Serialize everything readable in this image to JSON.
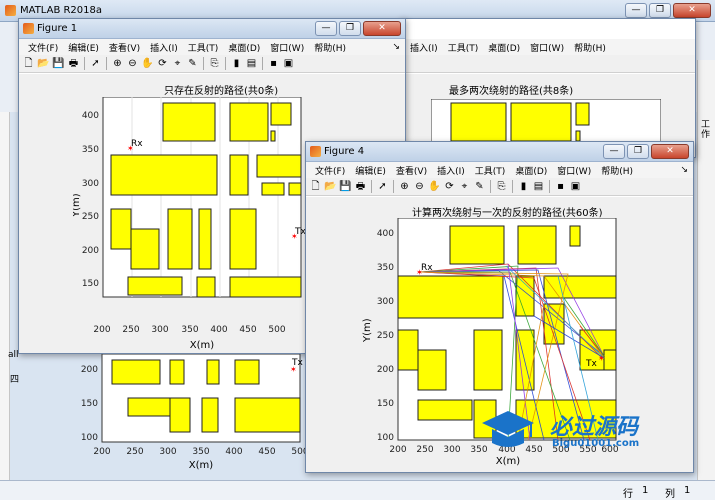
{
  "app": {
    "title": "MATLAB R2018a"
  },
  "figure1": {
    "title": "Figure 1",
    "plot_title": "只存在反射的路径(共0条)"
  },
  "figure_behind": {
    "plot_title": "最多两次绕射的路径(共8条)"
  },
  "figure4": {
    "title": "Figure 4",
    "plot_title": "计算两次绕射与一次的反射的路径(共60条)"
  },
  "menu": [
    "文件(F)",
    "编辑(E)",
    "查看(V)",
    "插入(I)",
    "工具(T)",
    "桌面(D)",
    "窗口(W)",
    "帮助(H)"
  ],
  "menu_tail": "↘",
  "axes": {
    "xlabel": "X(m)",
    "ylabel": "Y(m)",
    "rx_label": "Rx",
    "tx_label": "Tx"
  },
  "ticks": {
    "x": [
      "200",
      "250",
      "300",
      "350",
      "400",
      "450",
      "500"
    ],
    "y": [
      "100",
      "150",
      "200",
      "250",
      "300",
      "350",
      "400"
    ]
  },
  "ticks_fig4": {
    "x": [
      "200",
      "250",
      "300",
      "350",
      "400",
      "450",
      "500",
      "550",
      "600"
    ]
  },
  "status": {
    "row_label": "行",
    "row": "1",
    "col_label": "列",
    "col": "1"
  },
  "side": {
    "tool_label": "工作",
    "all_label": "all",
    "doc_label": "四"
  },
  "watermark": {
    "cn": "必过源码",
    "url": "Bigu01001.com"
  },
  "colors": {
    "building": "#ffff00",
    "rx": "#ff0000"
  }
}
